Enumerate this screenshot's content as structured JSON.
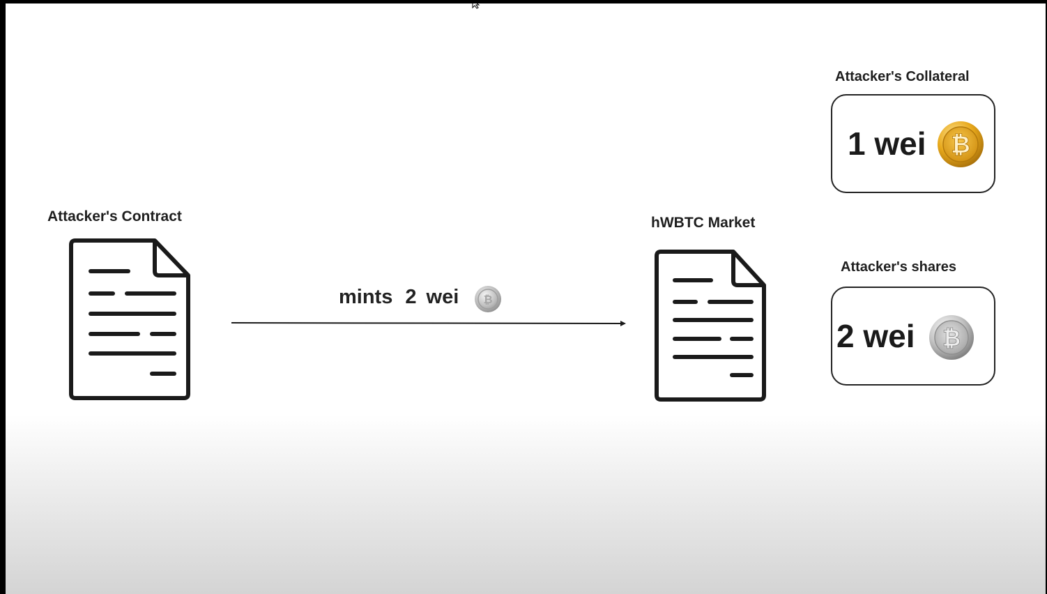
{
  "contract": {
    "label": "Attacker's Contract",
    "icon": "document-icon"
  },
  "market": {
    "label": "hWBTC Market",
    "icon": "document-icon"
  },
  "transfer": {
    "action": "mints",
    "amount": "2 wei",
    "coin_icon": "silver-coin-icon"
  },
  "collateral": {
    "label": "Attacker's Collateral",
    "value": "1 wei",
    "coin_icon": "bitcoin-coin-icon"
  },
  "shares": {
    "label": "Attacker's shares",
    "value": "2 wei",
    "coin_icon": "silver-coin-icon"
  },
  "colors": {
    "stroke": "#1a1a1a",
    "bitcoin_gold": "#e8a91c",
    "silver": "#bdbdbd"
  }
}
